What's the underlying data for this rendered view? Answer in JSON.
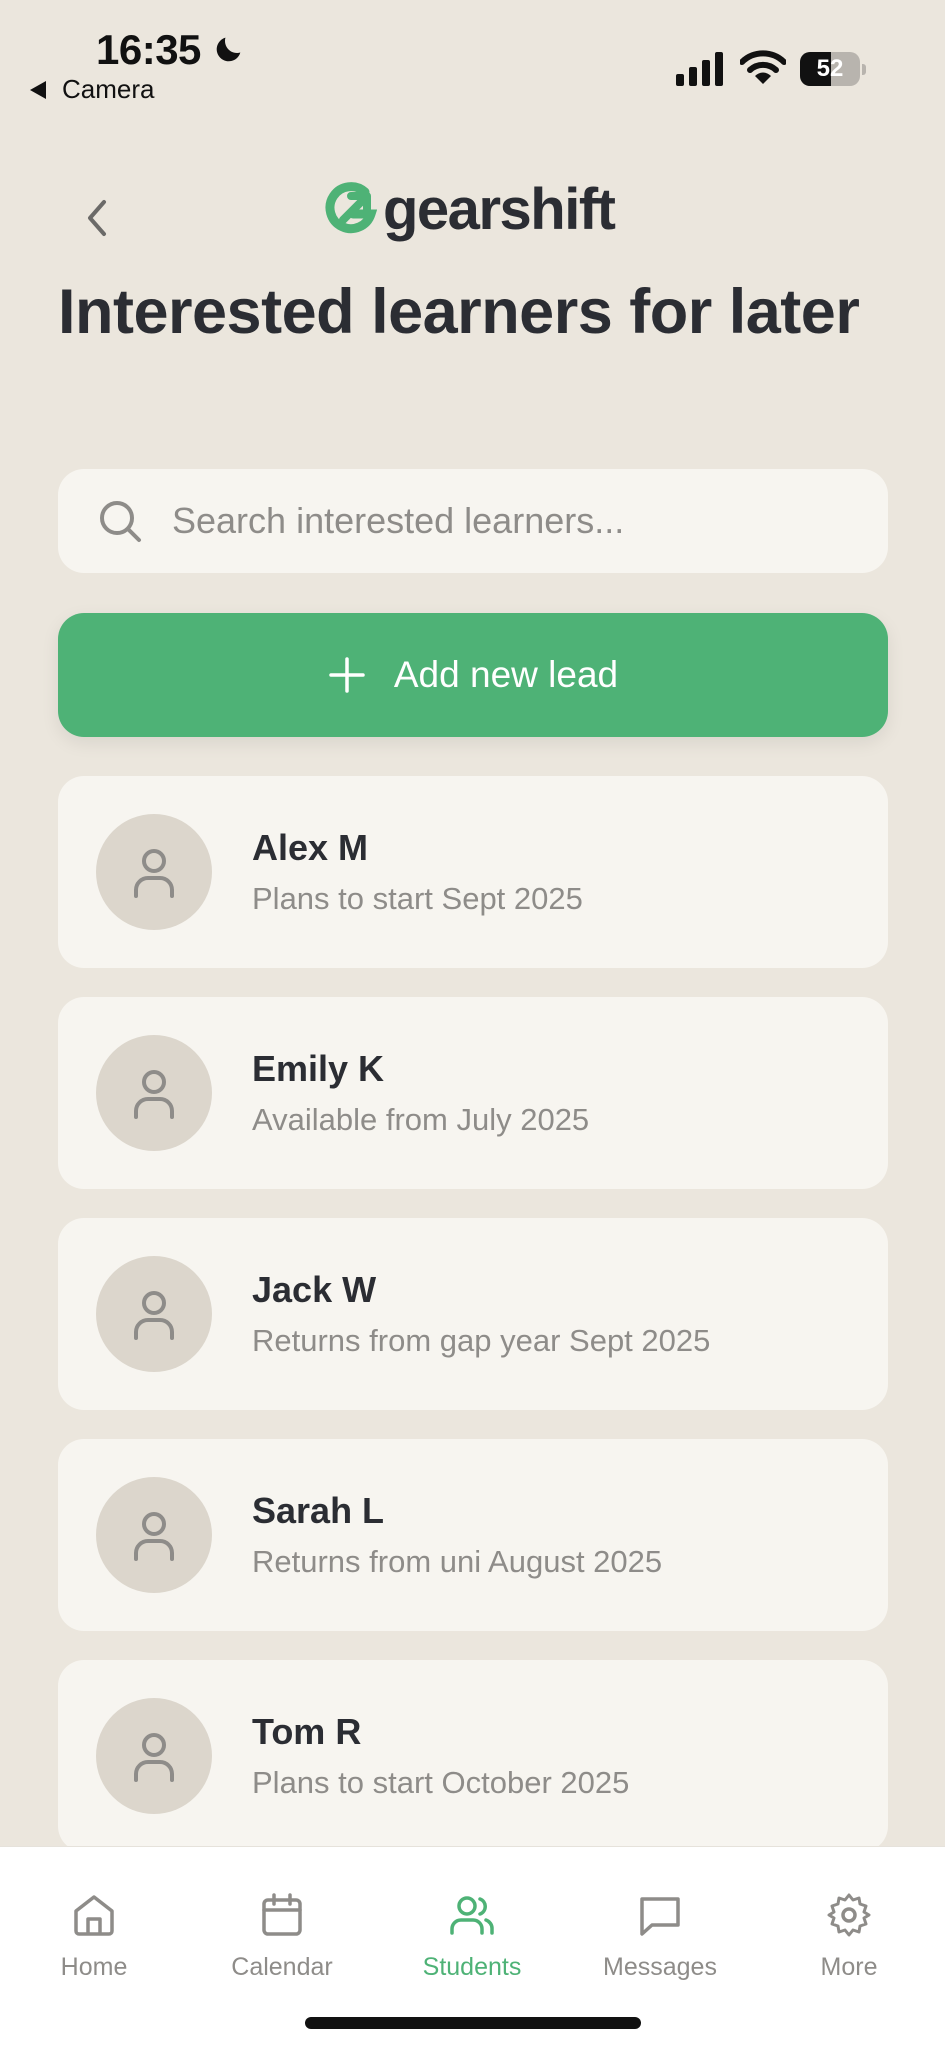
{
  "status_bar": {
    "time": "16:35",
    "back_app": "Camera",
    "battery_percent": "52",
    "battery_level": 0.52
  },
  "header": {
    "logo_text": "gearshift",
    "title": "Interested learners for later"
  },
  "search": {
    "placeholder": "Search interested learners...",
    "value": ""
  },
  "add_button": {
    "label": "Add new lead"
  },
  "leads": [
    {
      "name": "Alex M",
      "note": "Plans to start Sept 2025"
    },
    {
      "name": "Emily K",
      "note": "Available from July 2025"
    },
    {
      "name": "Jack W",
      "note": "Returns from gap year Sept 2025"
    },
    {
      "name": "Sarah L",
      "note": "Returns from uni August 2025"
    },
    {
      "name": "Tom R",
      "note": "Plans to start October 2025"
    }
  ],
  "nav": {
    "items": [
      {
        "label": "Home",
        "icon": "home-icon"
      },
      {
        "label": "Calendar",
        "icon": "calendar-icon"
      },
      {
        "label": "Students",
        "icon": "users-icon",
        "active": true
      },
      {
        "label": "Messages",
        "icon": "message-icon"
      },
      {
        "label": "More",
        "icon": "gear-icon"
      }
    ]
  },
  "colors": {
    "accent": "#4eb276",
    "background": "#ebe6dd",
    "card": "#f7f5f0",
    "text": "#2b2d33",
    "muted": "#8e8c89"
  }
}
